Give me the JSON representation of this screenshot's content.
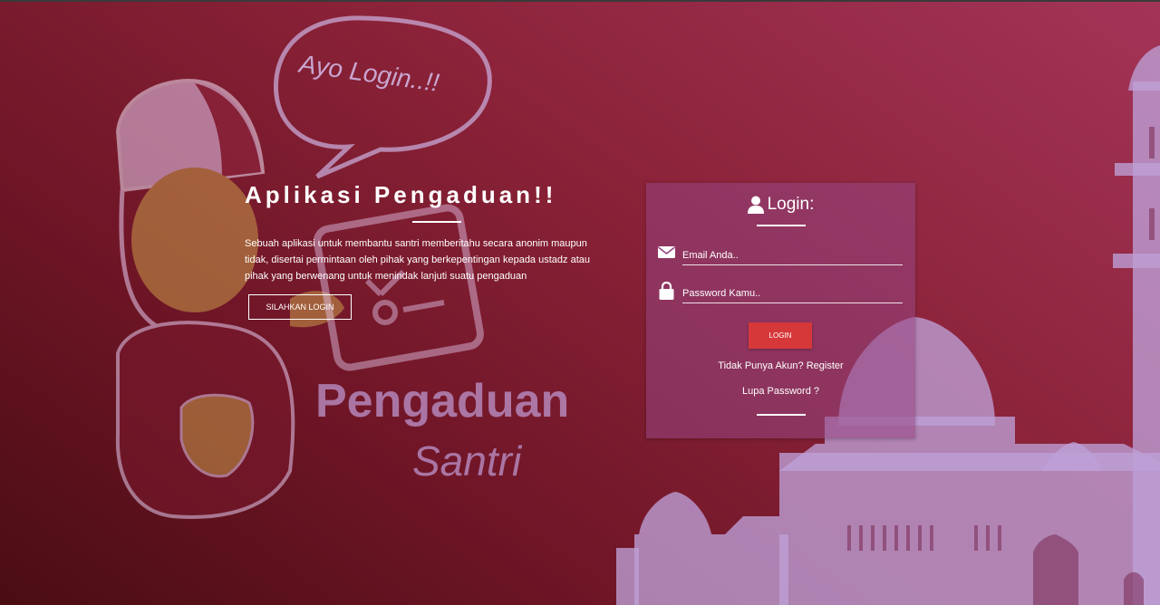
{
  "background": {
    "speech_bubble_text": "Ayo Login..!!",
    "logo_title": "Pengaduan",
    "logo_subtitle": "Santri"
  },
  "hero": {
    "title": "Aplikasi Pengaduan!!",
    "description": "Sebuah aplikasi untuk membantu santri memberitahu secara anonim maupun tidak, disertai permintaan oleh pihak yang berkepentingan kepada ustadz atau pihak yang berwenang untuk menindak lanjuti suatu pengaduan",
    "cta_label": "SILAHKAN LOGIN"
  },
  "login_card": {
    "title": "Login:",
    "email_placeholder": "Email Anda..",
    "password_placeholder": "Password Kamu..",
    "login_button": "LOGIN",
    "register_prompt": "Tidak Punya Akun?",
    "register_link": "Register",
    "forgot_link": "Lupa Password ?"
  },
  "colors": {
    "accent_button": "#d6383a",
    "card_bg": "rgba(150,70,130,0.55)",
    "bg_dark": "#4a0d12",
    "bg_light": "#a33458"
  },
  "icons": [
    "user-icon",
    "envelope-icon",
    "lock-icon"
  ]
}
